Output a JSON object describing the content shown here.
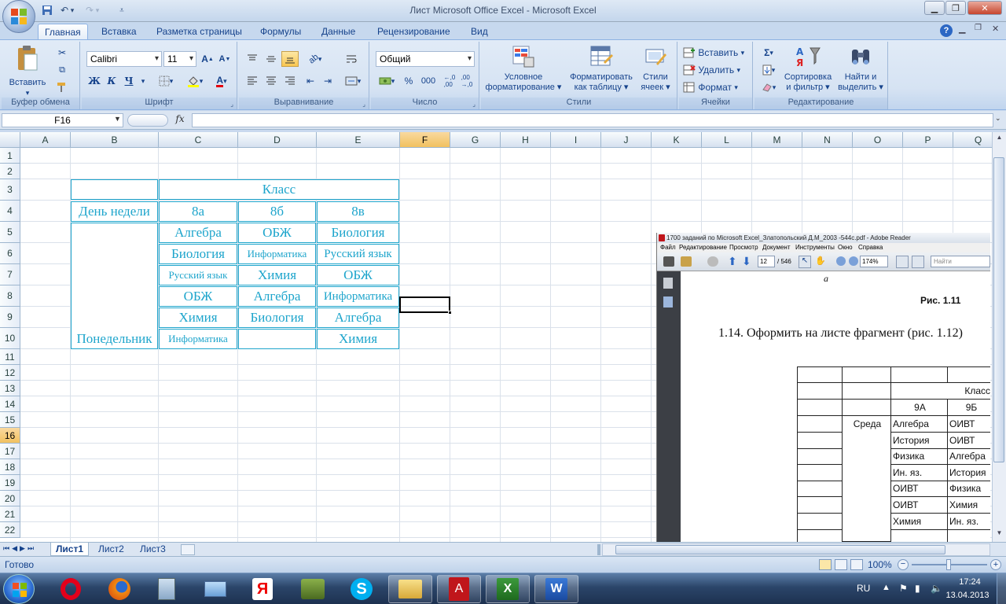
{
  "window": {
    "title": "Лист Microsoft Office Excel - Microsoft Excel"
  },
  "tabs": [
    {
      "label": "Главная",
      "active": true
    },
    {
      "label": "Вставка"
    },
    {
      "label": "Разметка страницы"
    },
    {
      "label": "Формулы"
    },
    {
      "label": "Данные"
    },
    {
      "label": "Рецензирование"
    },
    {
      "label": "Вид"
    }
  ],
  "ribbon": {
    "clipboard": {
      "label": "Буфер обмена",
      "paste": "Вставить"
    },
    "font": {
      "label": "Шрифт",
      "name": "Calibri",
      "size": "11",
      "bold": "Ж",
      "italic": "К",
      "underline": "Ч"
    },
    "alignment": {
      "label": "Выравнивание"
    },
    "number": {
      "label": "Число",
      "format": "Общий",
      "percent": "%",
      "thousands": "000"
    },
    "styles": {
      "label": "Стили",
      "conditional_line1": "Условное",
      "conditional_line2": "форматирование",
      "table_line1": "Форматировать",
      "table_line2": "как таблицу",
      "cell_line1": "Стили",
      "cell_line2": "ячеек"
    },
    "cells": {
      "label": "Ячейки",
      "insert": "Вставить",
      "delete": "Удалить",
      "format": "Формат"
    },
    "editing": {
      "label": "Редактирование",
      "sort_line1": "Сортировка",
      "sort_line2": "и фильтр",
      "find_line1": "Найти и",
      "find_line2": "выделить"
    }
  },
  "formula_bar": {
    "name_box": "F16",
    "fx": "fx",
    "value": ""
  },
  "columns": [
    "A",
    "B",
    "C",
    "D",
    "E",
    "F",
    "G",
    "H",
    "I",
    "J",
    "K",
    "L",
    "M",
    "N",
    "O",
    "P",
    "Q"
  ],
  "rows": [
    "1",
    "2",
    "3",
    "4",
    "5",
    "6",
    "7",
    "8",
    "9",
    "10",
    "11",
    "12",
    "13",
    "14",
    "15",
    "16",
    "17",
    "18",
    "19",
    "20",
    "21",
    "22"
  ],
  "table": {
    "header": "Класс",
    "day_header": "День недели",
    "classes": [
      "8а",
      "8б",
      "8в"
    ],
    "day": "Понедельник",
    "schedule": [
      [
        "Алгебра",
        "ОБЖ",
        "Биология"
      ],
      [
        "Биология",
        "Информатика",
        "Русский язык"
      ],
      [
        "Русский язык",
        "Химия",
        "ОБЖ"
      ],
      [
        "ОБЖ",
        "Алгебра",
        "Информатика"
      ],
      [
        "Химия",
        "Биология",
        "Алгебра"
      ],
      [
        "Информатика",
        "",
        "Химия"
      ]
    ]
  },
  "sheet_tabs": [
    "Лист1",
    "Лист2",
    "Лист3"
  ],
  "status": {
    "ready": "Готово",
    "zoom": "100%"
  },
  "pdf": {
    "title": "1700 заданий по Microsoft Excel_Златопольский Д.М_2003 -544с.pdf - Adobe Reader",
    "menu": [
      "Файл",
      "Редактирование",
      "Просмотр",
      "Документ",
      "Инструменты",
      "Окно",
      "Справка"
    ],
    "page": "12",
    "pages": "/ 546",
    "zoom": "174%",
    "find": "Найти",
    "caption_letter": "а",
    "figure_label": "Рис.  1.11",
    "task_text": "1.14. Оформить на листе фрагмент (рис. 1.12)",
    "table_header": "Класс",
    "classes": [
      "9А",
      "9Б"
    ],
    "day": "Среда",
    "col1": [
      "Алгебра",
      "История",
      "Физика",
      "Ин. яз.",
      "ОИВТ",
      "ОИВТ",
      "Химия"
    ],
    "col2": [
      "ОИВТ",
      "ОИВТ",
      "Алгебра",
      "История",
      "Физика",
      "Химия",
      "Ин. яз."
    ]
  },
  "taskbar": {
    "lang": "RU",
    "time": "17:24",
    "date": "13.04.2013"
  },
  "colors": {
    "cell_text": "#1ea5cc",
    "accent": "#15428b"
  }
}
